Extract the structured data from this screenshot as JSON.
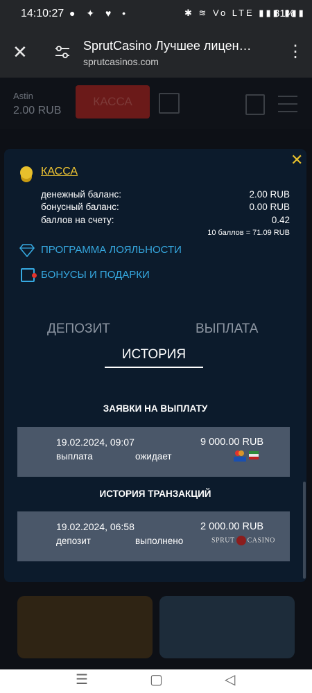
{
  "status_bar": {
    "time": "14:10:27",
    "app_icons": "● ✦ ♥ •",
    "right_icons": "✱ ≋ Vo LTE ▮▮▮ ▮▮▮",
    "battery": "81%"
  },
  "browser": {
    "title": "SprutCasino Лучшее лицен…",
    "url": "sprutcasinos.com"
  },
  "header": {
    "username": "Astin",
    "balance": "2.00 RUB",
    "kassa_button": "КАССА"
  },
  "modal": {
    "kassa_label": "КАССА",
    "balances": [
      {
        "label": "денежный баланс:",
        "value": "2.00 RUB"
      },
      {
        "label": "бонусный баланс:",
        "value": "0.00 RUB"
      },
      {
        "label": "баллов на счету:",
        "value": "0.42"
      }
    ],
    "points_note": "10 баллов = 71.09 RUB",
    "loyalty_link": "ПРОГРАММА ЛОЯЛЬНОСТИ",
    "bonus_link": "БОНУСЫ И ПОДАРКИ",
    "tabs": {
      "deposit": "ДЕПОЗИТ",
      "withdrawal": "ВЫПЛАТА",
      "history": "ИСТОРИЯ"
    },
    "withdrawals_title": "ЗАЯВКИ НА ВЫПЛАТУ",
    "withdrawals": [
      {
        "date": "19.02.2024, 09:07",
        "type": "выплата",
        "status": "ожидает",
        "amount": "9 000.00 RUB"
      }
    ],
    "transactions_title": "ИСТОРИЯ ТРАНЗАКЦИЙ",
    "transactions": [
      {
        "date": "19.02.2024, 06:58",
        "type": "депозит",
        "status": "выполнено",
        "amount": "2 000.00 RUB",
        "method_text": "SPRUT",
        "method_text_2": "CASINO"
      }
    ]
  },
  "colors": {
    "accent_gold": "#f0c532",
    "link_blue": "#36a9e1",
    "modal_bg": "#0c1b2c",
    "row_bg": "#4a5769"
  }
}
